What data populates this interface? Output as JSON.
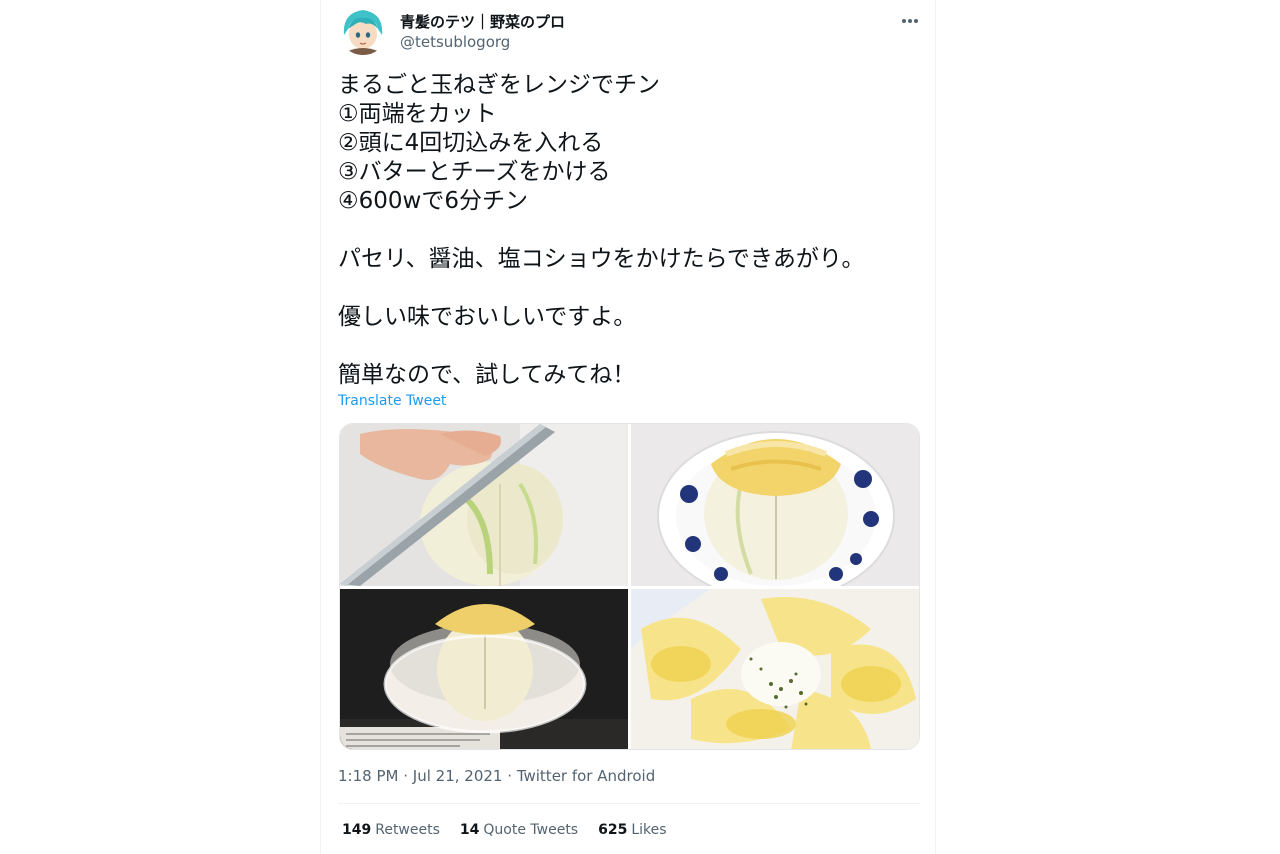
{
  "author": {
    "name": "青髪のテツ｜野菜のプロ",
    "handle": "@tetsublogorg"
  },
  "tweet": {
    "text": "まるごと玉ねぎをレンジでチン\n①両端をカット\n②頭に4回切込みを入れる\n③バターとチーズをかける\n④600wで6分チン\n\nパセリ、醤油、塩コショウをかけたらできあがり。\n\n優しい味でおいしいですよ。\n\n簡単なので、試してみてね！",
    "translate_label": "Translate Tweet"
  },
  "meta": {
    "time": "1:18 PM",
    "separator": "·",
    "date": "Jul 21, 2021",
    "source": "Twitter for Android"
  },
  "stats": {
    "retweets_count": "149",
    "retweets_label": "Retweets",
    "quotes_count": "14",
    "quotes_label": "Quote Tweets",
    "likes_count": "625",
    "likes_label": "Likes"
  },
  "icons": {
    "more": "more-horizontal-icon"
  },
  "colors": {
    "link": "#1d9bf0",
    "secondary_text": "#536471",
    "primary_text": "#0f1419"
  }
}
